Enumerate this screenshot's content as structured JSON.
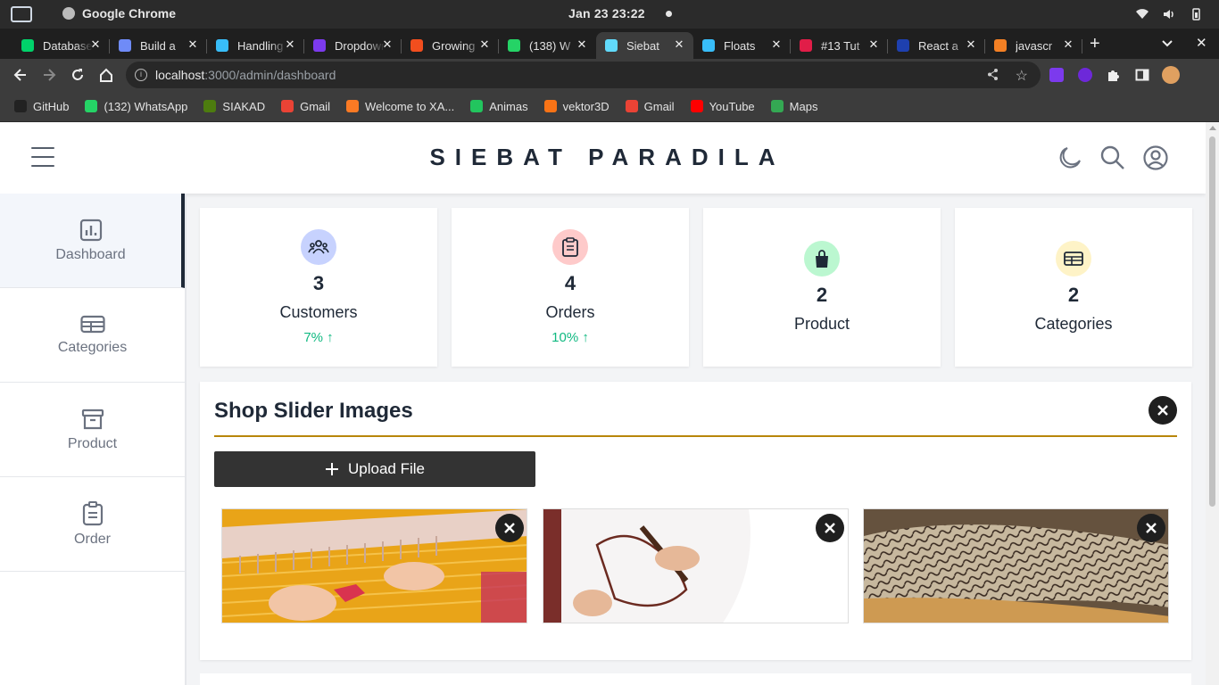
{
  "os": {
    "app_name": "Google Chrome",
    "clock": "Jan 23  23:22"
  },
  "tabs": [
    {
      "title": "Database",
      "color": "#00d26a"
    },
    {
      "title": "Build a",
      "color": "#6f8bf7"
    },
    {
      "title": "Handling",
      "color": "#38bdf8"
    },
    {
      "title": "Dropdown",
      "color": "#7c3aed"
    },
    {
      "title": "Growing",
      "color": "#f24e1e"
    },
    {
      "title": "(138) W",
      "color": "#25d366"
    },
    {
      "title": "Siebat",
      "color": "#61dafb"
    },
    {
      "title": "Floats",
      "color": "#38bdf8"
    },
    {
      "title": "#13 Tut",
      "color": "#e11d48"
    },
    {
      "title": "React a",
      "color": "#1e40af"
    },
    {
      "title": "javascr",
      "color": "#f48024"
    }
  ],
  "active_tab_index": 6,
  "url": {
    "host": "localhost",
    "rest": ":3000/admin/dashboard"
  },
  "bookmarks": [
    {
      "label": "GitHub",
      "color": "#222"
    },
    {
      "label": "(132) WhatsApp",
      "color": "#25d366"
    },
    {
      "label": "SIAKAD",
      "color": "#4d7c0f"
    },
    {
      "label": "Gmail",
      "color": "#ea4335"
    },
    {
      "label": "Welcome to XA...",
      "color": "#fb7a24"
    },
    {
      "label": "Animas",
      "color": "#22c55e"
    },
    {
      "label": "vektor3D",
      "color": "#f97316"
    },
    {
      "label": "Gmail",
      "color": "#ea4335"
    },
    {
      "label": "YouTube",
      "color": "#ff0000"
    },
    {
      "label": "Maps",
      "color": "#34a853"
    }
  ],
  "app": {
    "brand": "SIEBAT PARADILA",
    "sidebar": [
      {
        "label": "Dashboard",
        "icon": "chart-icon"
      },
      {
        "label": "Categories",
        "icon": "table-icon"
      },
      {
        "label": "Product",
        "icon": "archive-icon"
      },
      {
        "label": "Order",
        "icon": "clipboard-icon"
      }
    ],
    "stats": [
      {
        "value": "3",
        "label": "Customers",
        "trend": "7% ↑",
        "color": "#c7d2fe"
      },
      {
        "value": "4",
        "label": "Orders",
        "trend": "10% ↑",
        "color": "#fecaca"
      },
      {
        "value": "2",
        "label": "Product",
        "trend": "",
        "color": "#bbf7d0"
      },
      {
        "value": "2",
        "label": "Categories",
        "trend": "",
        "color": "#fef3c7"
      }
    ],
    "slider": {
      "title": "Shop Slider Images",
      "upload_label": "Upload File"
    }
  }
}
